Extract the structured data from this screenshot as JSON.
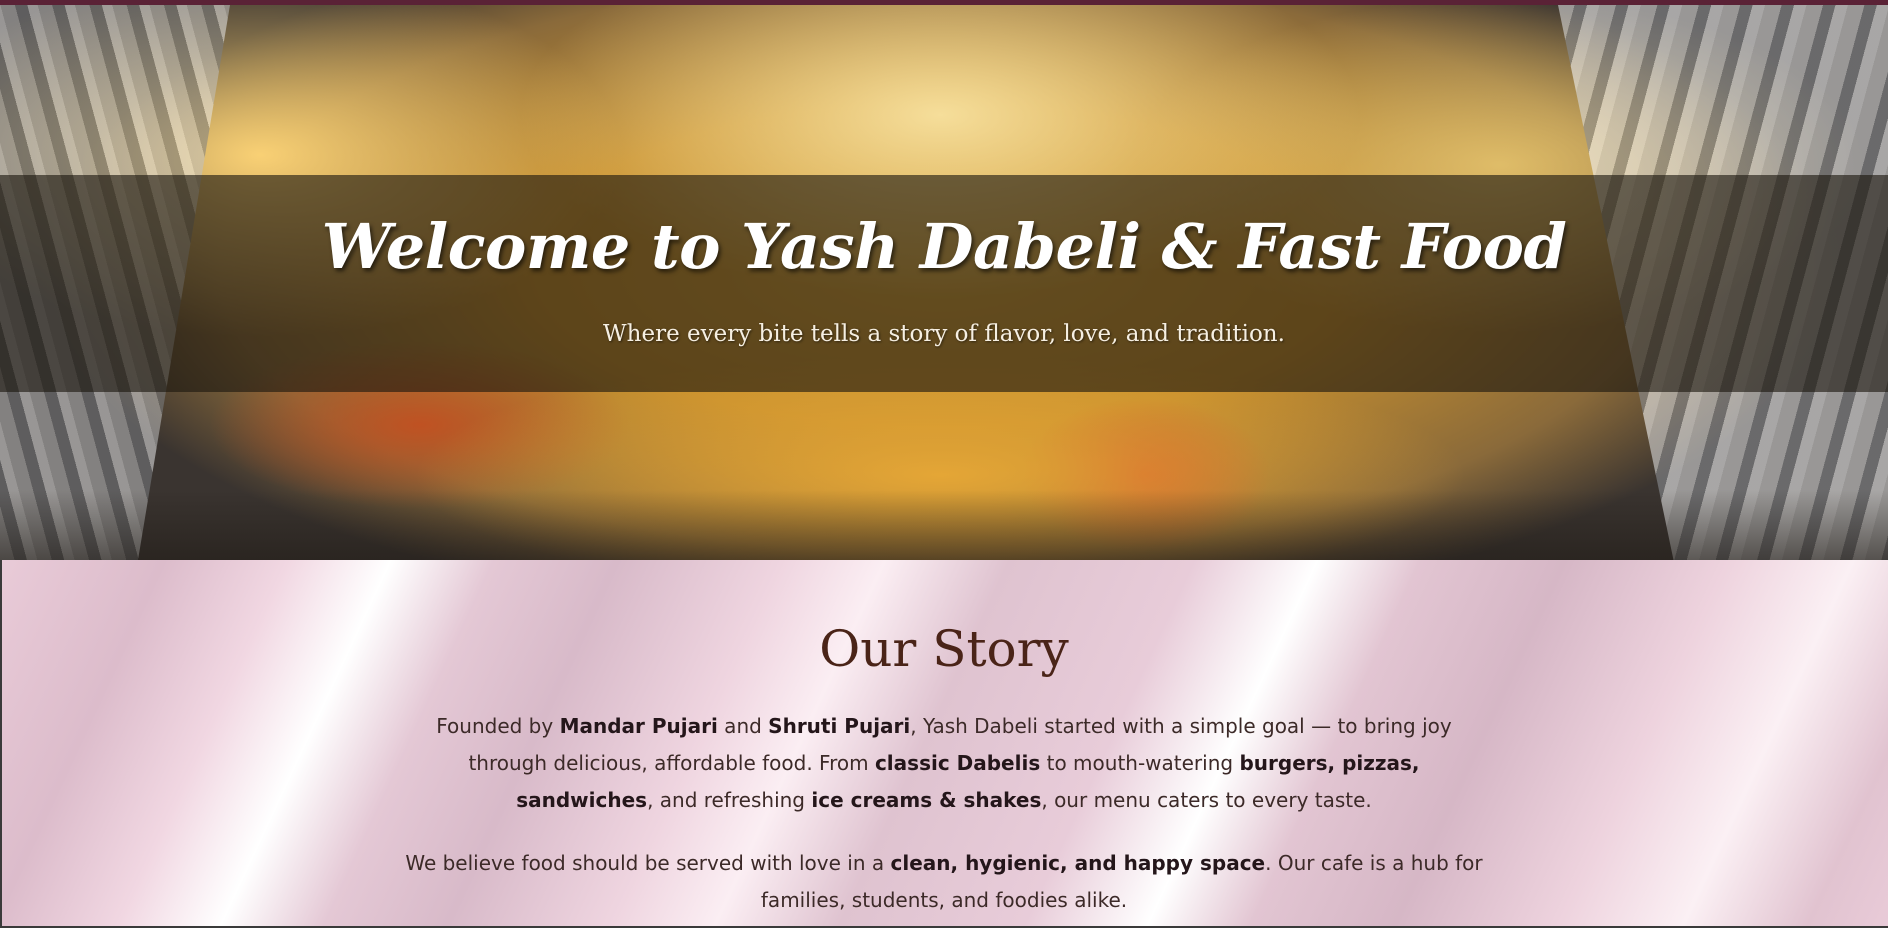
{
  "hero": {
    "title": "Welcome to Yash Dabeli & Fast Food",
    "subtitle": "Where every bite tells a story of flavor, love, and tradition."
  },
  "story": {
    "heading": "Our Story",
    "p1": {
      "t1": "Founded by ",
      "b1": "Mandar Pujari",
      "t2": " and ",
      "b2": "Shruti Pujari",
      "t3": ", Yash Dabeli started with a simple goal — to bring joy through delicious, affordable food. From ",
      "b3": "classic Dabelis",
      "t4": " to mouth-watering ",
      "b4": "burgers, pizzas, sandwiches",
      "t5": ", and refreshing ",
      "b5": "ice creams & shakes",
      "t6": ", our menu caters to every taste."
    },
    "p2": {
      "t1": "We believe food should be served with love in a ",
      "b1": "clean, hygienic, and happy space",
      "t2": ". Our cafe is a hub for families, students, and foodies alike."
    }
  }
}
